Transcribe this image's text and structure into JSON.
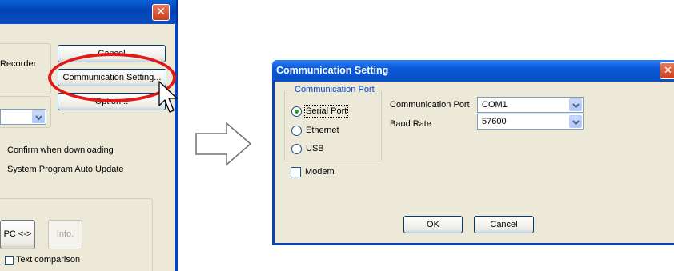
{
  "left_window": {
    "partial_label_recorder": "Recorder",
    "cancel_label": "Cancel",
    "communication_setting_label": "Communication Setting...",
    "option_label": "Option...",
    "confirm_downloading_label": "Confirm when downloading",
    "system_update_label": "System Program Auto Update",
    "pc_compare_label": "PC <->",
    "info_label": "Info.",
    "text_comparison_label": "Text comparison"
  },
  "dialog": {
    "title": "Communication Setting",
    "group_title": "Communication Port",
    "radio_options": [
      {
        "label": "Serial Port",
        "checked": true
      },
      {
        "label": "Ethernet",
        "checked": false
      },
      {
        "label": "USB",
        "checked": false
      }
    ],
    "modem_label": "Modem",
    "modem_checked": false,
    "port_label": "Communication Port",
    "port_value": "COM1",
    "baud_label": "Baud Rate",
    "baud_value": "57600",
    "ok_label": "OK",
    "cancel_label": "Cancel"
  },
  "colors": {
    "titlebar": "#0a58d8",
    "highlight_ellipse": "#e01a1a",
    "dialog_face": "#ece9d8",
    "group_title": "#0046d5"
  },
  "icons": [
    "close-icon",
    "dropdown-arrow-icon",
    "mouse-pointer-icon",
    "right-arrow-icon"
  ]
}
